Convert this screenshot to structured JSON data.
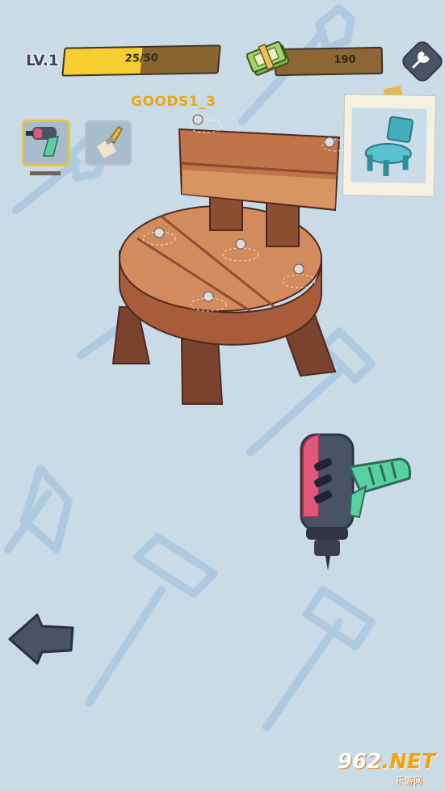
{
  "hud": {
    "level_label": "LV.1",
    "xp_text": "25/50",
    "xp_progress": 0.5,
    "money_text": "190"
  },
  "goods": {
    "label": "GOODS1_3"
  },
  "tools": [
    {
      "icon": "drill-icon",
      "selected": true
    },
    {
      "icon": "brush-icon",
      "selected": false
    }
  ],
  "colors": {
    "background": "#c9dbe7",
    "xp_fill": "#f5cf2f",
    "goods_label": "#e7a912",
    "wood": "#b86a43",
    "target_chair": "#48b9c3",
    "drill_body": "#4a5365",
    "drill_accent": "#df5a7a",
    "drill_handle": "#57d1a1"
  },
  "watermark": {
    "main": "962",
    "suffix": ".NET",
    "sub": "乐游网"
  }
}
